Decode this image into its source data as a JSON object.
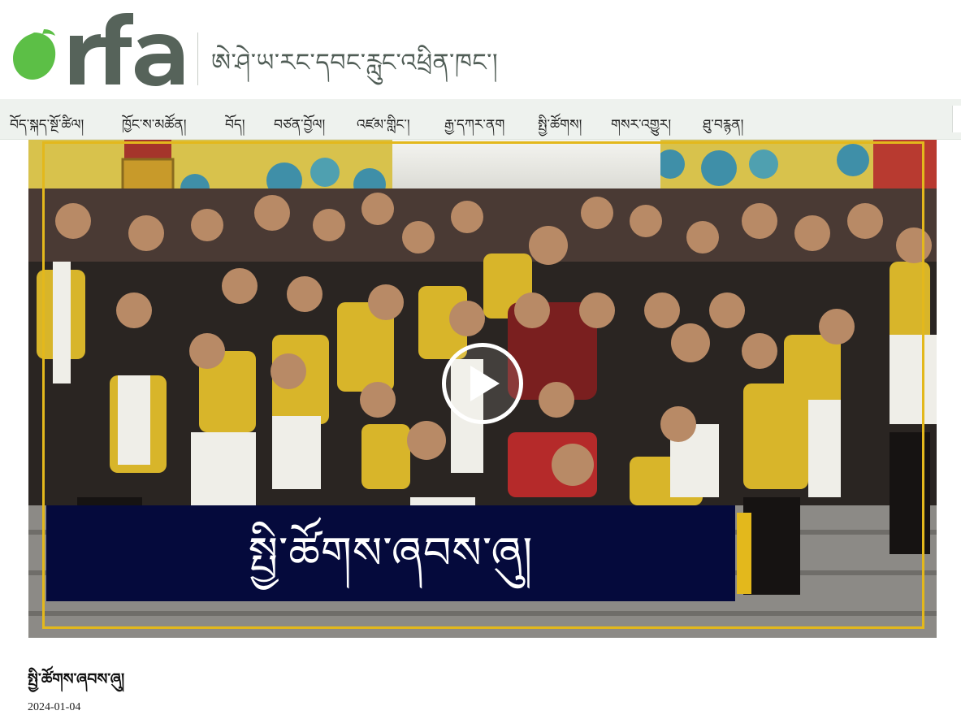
{
  "header": {
    "logo_text": "rfa",
    "tagline": "ཨེ་ཤེ་ཡ་རང་དབང་རླུང་འཕྲིན་ཁང་།",
    "colors": {
      "logo_dot": "#5cbf46",
      "logo_text": "#56635a"
    }
  },
  "nav": {
    "items": [
      {
        "label": "བོད་སྐད་སྔོ་ཚིལ།"
      },
      {
        "label": "ཁྱོང་ས་མཚོན།"
      },
      {
        "label": "བོད།"
      },
      {
        "label": "བཙན་བྱོལ།"
      },
      {
        "label": "འཛམ་གླིང་།"
      },
      {
        "label": "རྒྱ་དཀར་ནག"
      },
      {
        "label": "སྤྱི་ཚོགས།"
      },
      {
        "label": "གསར་འགྱུར།"
      },
      {
        "label": "ཐུ་བརྙན།"
      }
    ]
  },
  "hero": {
    "banner_text": "སྤྱི་ཚོགས་ཞབས་ཞུ།",
    "play_icon": "play-icon",
    "colors": {
      "frame": "#e3b81c",
      "banner": "#050a3c"
    }
  },
  "article": {
    "title": "སྤྱི་ཚོགས་ཞབས་ཞུ།",
    "date": "2024-01-04"
  }
}
